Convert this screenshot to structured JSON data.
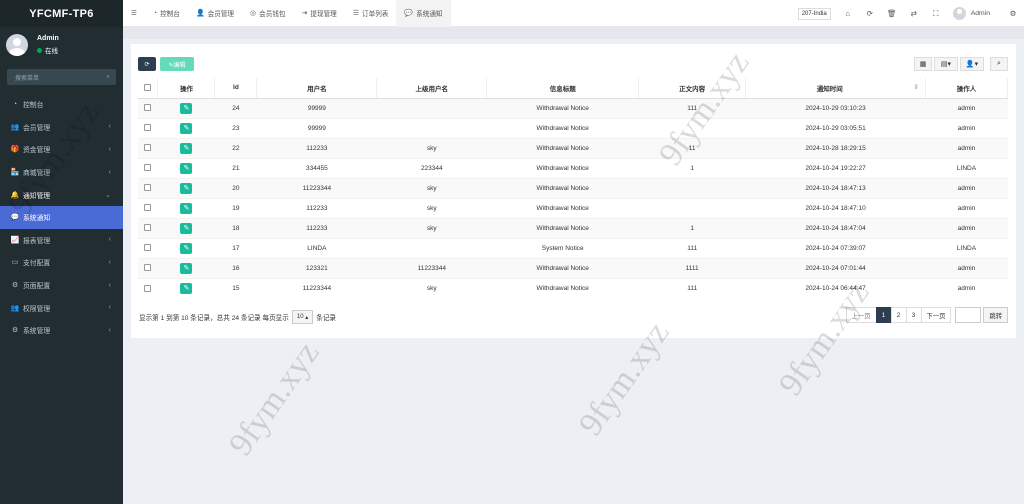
{
  "logo": "YFCMF-TP6",
  "user": {
    "name": "Admin",
    "status": "在线"
  },
  "search_placeholder": "搜索菜单",
  "menu": [
    {
      "icon": "dashboard-icon",
      "glyph": "◔",
      "label": "控制台",
      "chevron": ""
    },
    {
      "icon": "users-icon",
      "glyph": "👥",
      "label": "会员管理",
      "chevron": "‹"
    },
    {
      "icon": "gift-icon",
      "glyph": "🎁",
      "label": "资金管理",
      "chevron": "‹"
    },
    {
      "icon": "shop-icon",
      "glyph": "🏪",
      "label": "商城管理",
      "chevron": "‹"
    },
    {
      "icon": "bell-icon",
      "glyph": "🔔",
      "label": "通知管理",
      "chevron": "⌄"
    },
    {
      "icon": "comments-icon",
      "glyph": "💬",
      "label": "系统通知",
      "chevron": ""
    },
    {
      "icon": "chart-icon",
      "glyph": "📈",
      "label": "报表管理",
      "chevron": "‹"
    },
    {
      "icon": "card-icon",
      "glyph": "▭",
      "label": "支付配置",
      "chevron": "‹"
    },
    {
      "icon": "cog-icon",
      "glyph": "⚙",
      "label": "页面配置",
      "chevron": "‹"
    },
    {
      "icon": "group-icon",
      "glyph": "👥",
      "label": "权限管理",
      "chevron": "‹"
    },
    {
      "icon": "cogs-icon",
      "glyph": "⚙",
      "label": "系统管理",
      "chevron": "‹"
    }
  ],
  "tabs": [
    {
      "icon": "dashboard-icon",
      "glyph": "◔",
      "label": "控制台"
    },
    {
      "icon": "user-icon",
      "glyph": "👤",
      "label": "会员管理"
    },
    {
      "icon": "wallet-icon",
      "glyph": "◎",
      "label": "会员钱包"
    },
    {
      "icon": "sign-out-icon",
      "glyph": "⇥",
      "label": "提现管理"
    },
    {
      "icon": "list-icon",
      "glyph": "☰",
      "label": "订单列表"
    },
    {
      "icon": "comments-icon",
      "glyph": "💬",
      "label": "系统通知"
    }
  ],
  "top_right": {
    "lang": "207-India",
    "username": "Admin"
  },
  "toolbar": {
    "refresh_glyph": "⟳",
    "edit_label": "✎编辑"
  },
  "table": {
    "headers": [
      "",
      "操作",
      "Id",
      "用户名",
      "上级用户名",
      "信息标题",
      "正文内容",
      "通知时间",
      "操作人"
    ],
    "rows": [
      {
        "id": "24",
        "username": "99999",
        "parent": "",
        "title": "Withdrawal Notice",
        "content": "111",
        "time": "2024-10-29 03:10:23",
        "operator": "admin"
      },
      {
        "id": "23",
        "username": "99999",
        "parent": "",
        "title": "Withdrawal Notice",
        "content": "",
        "time": "2024-10-29 03:05:51",
        "operator": "admin"
      },
      {
        "id": "22",
        "username": "112233",
        "parent": "sky",
        "title": "Withdrawal Notice",
        "content": "11",
        "time": "2024-10-28 18:29:15",
        "operator": "admin"
      },
      {
        "id": "21",
        "username": "334455",
        "parent": "223344",
        "title": "Withdrawal Notice",
        "content": "1",
        "time": "2024-10-24 19:22:27",
        "operator": "LINDA"
      },
      {
        "id": "20",
        "username": "11223344",
        "parent": "sky",
        "title": "Withdrawal Notice",
        "content": "",
        "time": "2024-10-24 18:47:13",
        "operator": "admin"
      },
      {
        "id": "19",
        "username": "112233",
        "parent": "sky",
        "title": "Withdrawal Notice",
        "content": "",
        "time": "2024-10-24 18:47:10",
        "operator": "admin"
      },
      {
        "id": "18",
        "username": "112233",
        "parent": "sky",
        "title": "Withdrawal Notice",
        "content": "1",
        "time": "2024-10-24 18:47:04",
        "operator": "admin"
      },
      {
        "id": "17",
        "username": "LINDA",
        "parent": "",
        "title": "System Notice",
        "content": "111",
        "time": "2024-10-24 07:39:07",
        "operator": "LINDA"
      },
      {
        "id": "16",
        "username": "123321",
        "parent": "11223344",
        "title": "Withdrawal Notice",
        "content": "1111",
        "time": "2024-10-24 07:01:44",
        "operator": "admin"
      },
      {
        "id": "15",
        "username": "11223344",
        "parent": "sky",
        "title": "Withdrawal Notice",
        "content": "111",
        "time": "2024-10-24 06:44:47",
        "operator": "admin"
      }
    ]
  },
  "pagination": {
    "info": "显示第 1 到第 10 条记录，总共 24 条记录 每页显示",
    "per_page": "10",
    "suffix": "条记录",
    "prev": "上一页",
    "pages": [
      "1",
      "2",
      "3"
    ],
    "next": "下一页",
    "jump": "跳转"
  },
  "watermark": "9fym.xyz"
}
